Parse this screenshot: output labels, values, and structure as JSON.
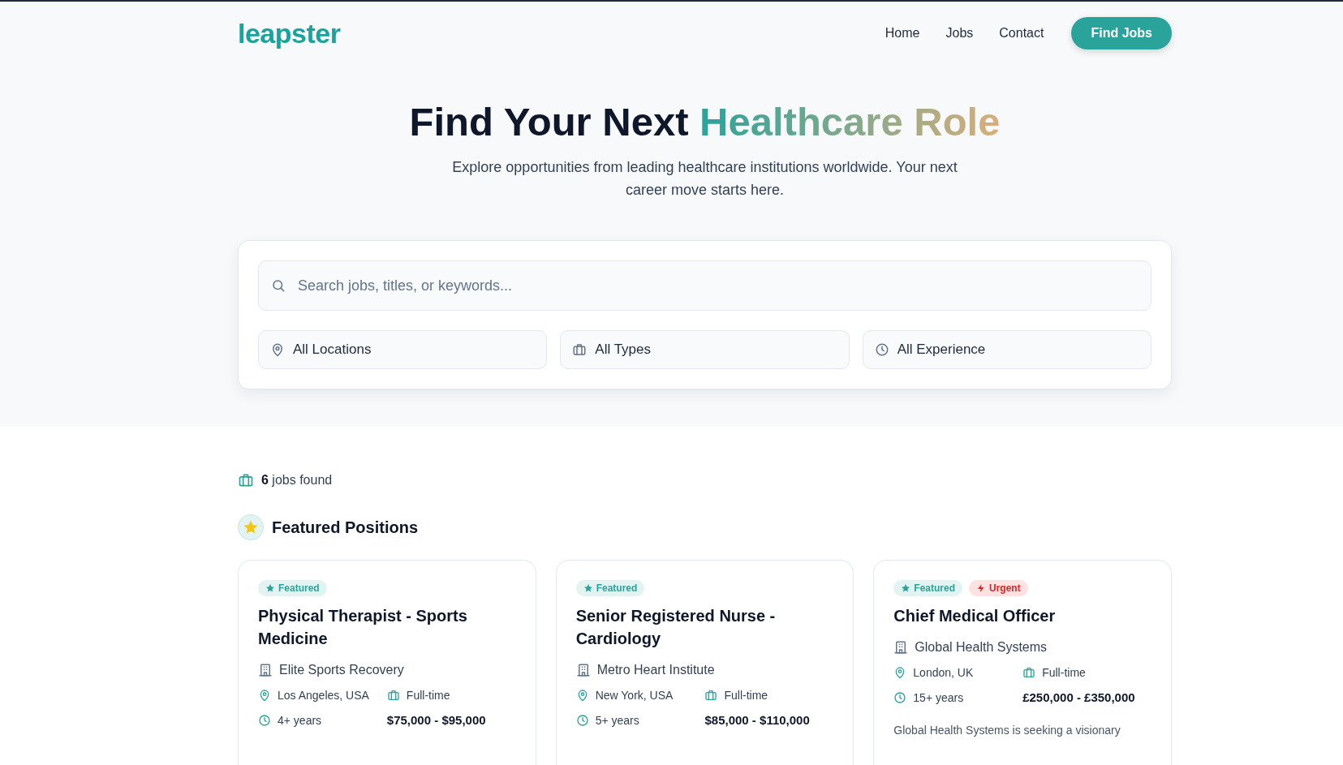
{
  "header": {
    "logo": "leapster",
    "nav": [
      {
        "label": "Home"
      },
      {
        "label": "Jobs"
      },
      {
        "label": "Contact"
      }
    ],
    "cta": "Find Jobs"
  },
  "hero": {
    "title_lead": "Find Your Next",
    "title_highlight": "Healthcare Role",
    "subtitle": "Explore opportunities from leading healthcare institutions worldwide. Your next career move starts here."
  },
  "search": {
    "placeholder": "Search jobs, titles, or keywords...",
    "filters": [
      {
        "kind": "location",
        "label": "All Locations"
      },
      {
        "kind": "type",
        "label": "All Types"
      },
      {
        "kind": "experience",
        "label": "All Experience"
      }
    ]
  },
  "results": {
    "count_text": "**6** jobs found"
  },
  "featured": {
    "heading": "Featured Positions",
    "jobs": [
      {
        "badges": [
          {
            "kind": "featured",
            "label": "Featured"
          }
        ],
        "title": "Physical Therapist - Sports Medicine",
        "company": "Elite Sports Recovery",
        "location": "Los Angeles, USA",
        "type": "Full-time",
        "experience": "4+ years",
        "salary": "$75,000 - $95,000"
      },
      {
        "badges": [
          {
            "kind": "featured",
            "label": "Featured"
          }
        ],
        "title": "Senior Registered Nurse - Cardiology",
        "company": "Metro Heart Institute",
        "location": "New York, USA",
        "type": "Full-time",
        "experience": "5+ years",
        "salary": "$85,000 - $110,000"
      },
      {
        "badges": [
          {
            "kind": "featured",
            "label": "Featured"
          },
          {
            "kind": "urgent",
            "label": "Urgent"
          }
        ],
        "title": "Chief Medical Officer",
        "company": "Global Health Systems",
        "location": "London, UK",
        "type": "Full-time",
        "experience": "15+ years",
        "salary": "£250,000 - £350,000",
        "description": "Global Health Systems is seeking a visionary"
      }
    ]
  }
}
